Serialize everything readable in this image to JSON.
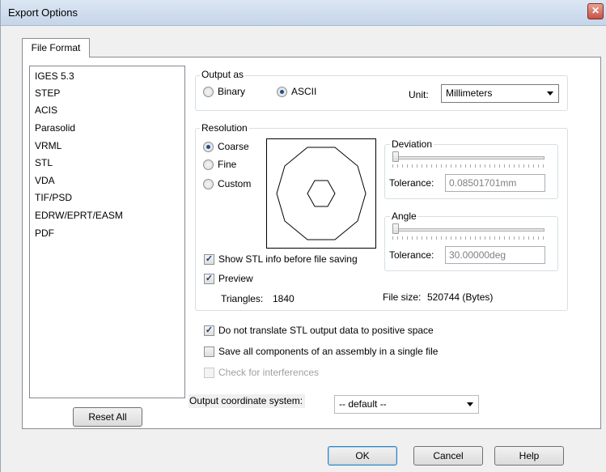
{
  "window": {
    "title": "Export Options",
    "close_glyph": "✕"
  },
  "tab": {
    "label": "File Format"
  },
  "formats": [
    "IGES 5.3",
    "STEP",
    "ACIS",
    "Parasolid",
    "VRML",
    "STL",
    "VDA",
    "TIF/PSD",
    "EDRW/EPRT/EASM",
    "PDF"
  ],
  "reset_all_label": "Reset All",
  "output_as": {
    "label": "Output as",
    "binary_label": "Binary",
    "ascii_label": "ASCII",
    "selected": "ASCII",
    "unit_label": "Unit:",
    "unit_value": "Millimeters"
  },
  "resolution": {
    "label": "Resolution",
    "coarse_label": "Coarse",
    "fine_label": "Fine",
    "custom_label": "Custom",
    "selected": "Coarse",
    "deviation": {
      "label": "Deviation",
      "tolerance_label": "Tolerance:",
      "tolerance_value": "0.08501701mm",
      "slider_level": 0
    },
    "angle": {
      "label": "Angle",
      "tolerance_label": "Tolerance:",
      "tolerance_value": "30.00000deg",
      "slider_level": 0
    },
    "show_info_label": "Show STL info before file saving",
    "show_info_checked": true,
    "preview_label": "Preview",
    "preview_checked": true,
    "triangles_label": "Triangles:",
    "triangles_value": "1840",
    "file_size_label": "File size:",
    "file_size_value": "520744 (Bytes)"
  },
  "options": {
    "no_translate_label": "Do not translate STL output data to positive space",
    "no_translate_checked": true,
    "save_single_label": "Save all components of an assembly in a single file",
    "save_single_checked": false,
    "interferences_label": "Check for interferences",
    "interferences_checked": false
  },
  "coordinate": {
    "label": "Output coordinate system:",
    "value": "-- default --"
  },
  "buttons": {
    "ok": "OK",
    "cancel": "Cancel",
    "help": "Help"
  },
  "check_glyph": "✓"
}
